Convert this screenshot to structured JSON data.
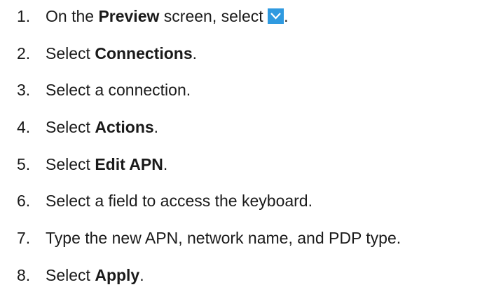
{
  "steps": [
    {
      "number": "1.",
      "pre": "On the ",
      "bold": "Preview",
      "post": " screen, select ",
      "icon": "chevron-down-icon",
      "end": "."
    },
    {
      "number": "2.",
      "pre": "Select ",
      "bold": "Connections",
      "post": "."
    },
    {
      "number": "3.",
      "text": "Select a connection."
    },
    {
      "number": "4.",
      "pre": "Select ",
      "bold": "Actions",
      "post": "."
    },
    {
      "number": "5.",
      "pre": "Select ",
      "bold": "Edit APN",
      "post": "."
    },
    {
      "number": "6.",
      "text": "Select a field to access the keyboard."
    },
    {
      "number": "7.",
      "text": "Type the new APN, network name, and PDP type."
    },
    {
      "number": "8.",
      "pre": "Select ",
      "bold": "Apply",
      "post": "."
    }
  ],
  "colors": {
    "icon_background": "#2f9ae0",
    "icon_glyph": "#ffffff",
    "text": "#1a1a1a"
  }
}
